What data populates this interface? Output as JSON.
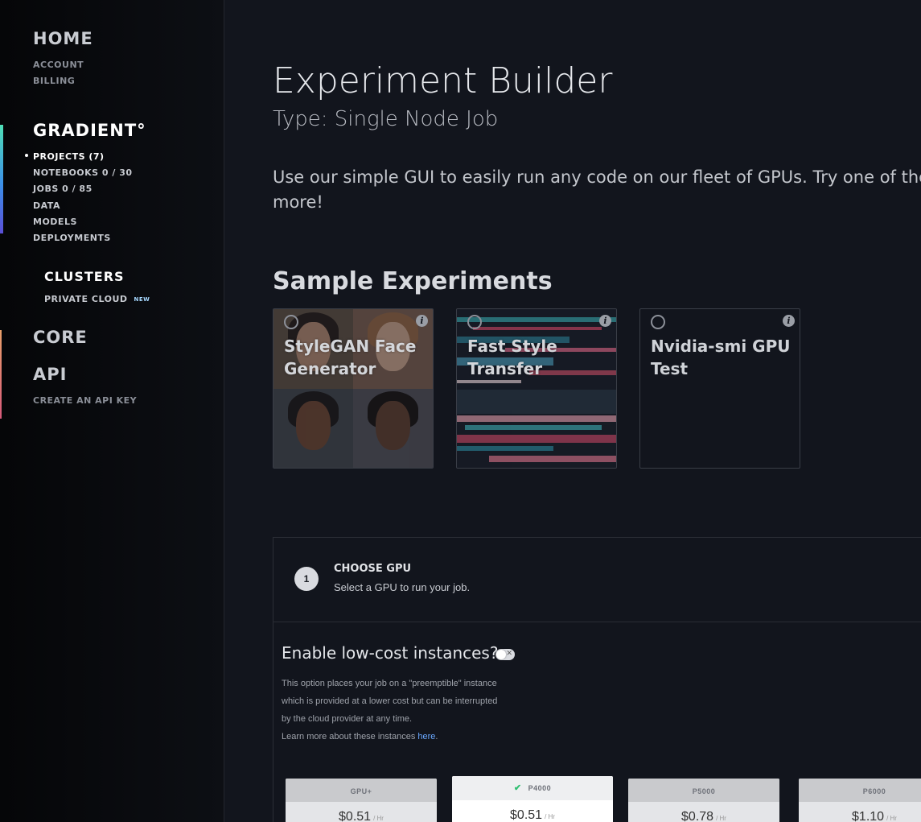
{
  "sidebar": {
    "home": "HOME",
    "account": "ACCOUNT",
    "billing": "BILLING",
    "gradient": "GRADIENT°",
    "projects": "PROJECTS  (7)",
    "notebooks": "NOTEBOOKS  0 / 30",
    "jobs": "JOBS  0 / 85",
    "data": "DATA",
    "models": "MODELS",
    "deployments": "DEPLOYMENTS",
    "clusters": "CLUSTERS",
    "private_cloud": "PRIVATE CLOUD",
    "new_badge": "NEW",
    "core": "CORE",
    "api": "API",
    "create_api_key": "CREATE AN API KEY"
  },
  "main": {
    "title": "Experiment Builder",
    "subtitle": "Type: Single Node Job",
    "intro": "Use our simple GUI to easily run any code on our fleet of GPUs. Try one of the sa more!",
    "intro_line1": "Use our simple GUI to easily run any code on our fleet of GPUs. Try one of the sa",
    "intro_line2": "more!",
    "samples_title": "Sample Experiments",
    "samples": [
      {
        "label": "StyleGAN Face Generator"
      },
      {
        "label": "Fast Style Transfer"
      },
      {
        "label": "Nvidia-smi GPU Test"
      }
    ],
    "info_glyph": "i"
  },
  "step": {
    "number": "1",
    "title": "CHOOSE GPU",
    "description": "Select a GPU to run your job.",
    "lowcost_title": "Enable low-cost instances?",
    "lowcost_toggle": "off",
    "lowcost_text_1": "This option places your job on a \"preemptible\" instance",
    "lowcost_text_2": "which is provided at a lower cost but can be interrupted",
    "lowcost_text_3": "by the cloud provider at any time.",
    "lowcost_text_4": "Learn more about these instances",
    "lowcost_link": "here",
    "lowcost_period": "."
  },
  "gpus": [
    {
      "name": "GPU+",
      "price": "$0.51",
      "unit": "/ Hr",
      "selected": false
    },
    {
      "name": "P4000",
      "price": "$0.51",
      "unit": "/ Hr",
      "selected": true
    },
    {
      "name": "P5000",
      "price": "$0.78",
      "unit": "/ Hr",
      "selected": false
    },
    {
      "name": "P6000",
      "price": "$1.10",
      "unit": "/ Hr",
      "selected": false
    }
  ],
  "colors": {
    "background": "#12151d",
    "accent_top": "#4fe0b6",
    "accent_bottom": "#5a4fd6",
    "link": "#6aa8ff",
    "check": "#2fbf71"
  }
}
